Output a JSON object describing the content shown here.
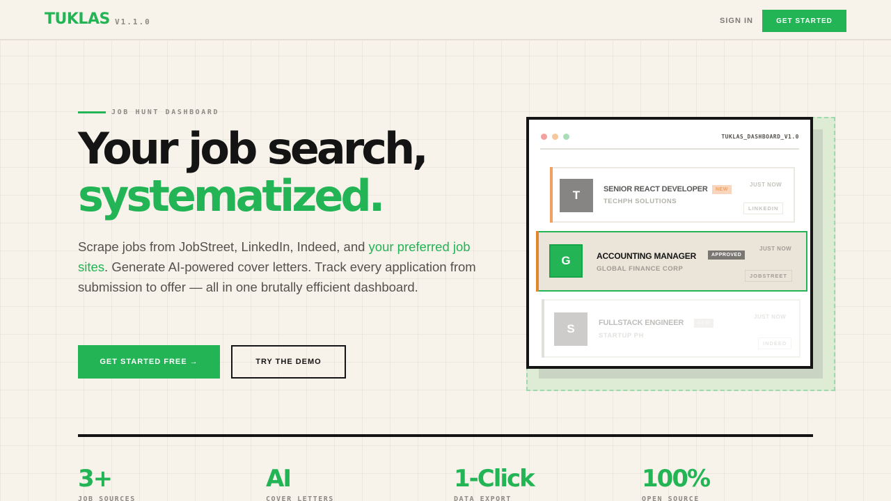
{
  "header": {
    "logo": "TUKLAS",
    "version": "V1.1.0",
    "sign_in": "SIGN IN",
    "get_started": "GET STARTED"
  },
  "hero": {
    "eyebrow": "JOB HUNT DASHBOARD",
    "headline_line1": "Your job search,",
    "headline_line2": "systematized.",
    "description_pre": "Scrape jobs from JobStreet, LinkedIn, Indeed, and ",
    "description_highlight": "your preferred job sites",
    "description_post": ". Generate AI-powered cover letters. Track every application from submission to offer — all in one brutally efficient dashboard.",
    "primary_cta": "GET STARTED FREE →",
    "secondary_cta": "TRY THE DEMO"
  },
  "dashboard": {
    "window_title": "TUKLAS_DASHBOARD_V1.0",
    "cards": [
      {
        "initial": "T",
        "title": "SENIOR REACT DEVELOPER",
        "badge": "NEW",
        "company": "TECHPH SOLUTIONS",
        "time": "JUST NOW",
        "source": "LINKEDIN"
      },
      {
        "initial": "G",
        "title": "ACCOUNTING MANAGER",
        "badge": "APPROVED",
        "company": "GLOBAL FINANCE CORP",
        "time": "JUST NOW",
        "source": "JOBSTREET"
      },
      {
        "initial": "S",
        "title": "FULLSTACK ENGINEER",
        "badge": "NEW",
        "company": "STARTUP PH",
        "time": "JUST NOW",
        "source": "INDEED"
      }
    ]
  },
  "stats": [
    {
      "value": "3+",
      "label": "JOB SOURCES"
    },
    {
      "value": "AI",
      "label": "COVER LETTERS"
    },
    {
      "value": "1-Click",
      "label": "DATA EXPORT"
    },
    {
      "value": "100%",
      "label": "OPEN SOURCE"
    }
  ],
  "colors": {
    "brand_green": "#22b455",
    "background": "#f7f2ea",
    "ink": "#141414"
  }
}
